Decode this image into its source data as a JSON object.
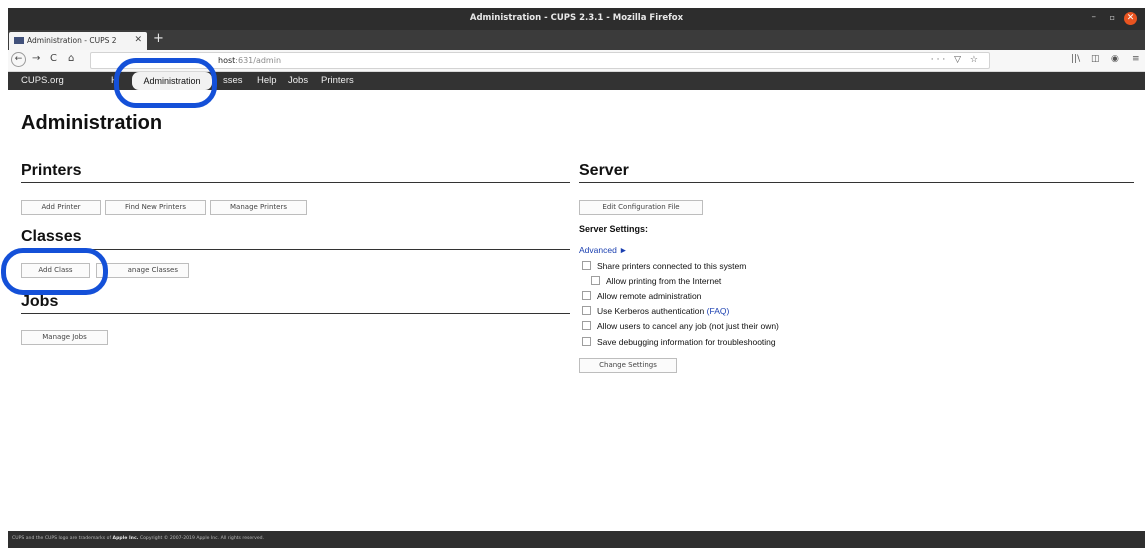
{
  "window": {
    "title": "Administration - CUPS 2.3.1 - Mozilla Firefox",
    "min": "–",
    "max": "▫",
    "close": "✕"
  },
  "tab": {
    "title": "Administration - CUPS 2",
    "close": "✕",
    "new_tab": "+"
  },
  "nav": {
    "back": "←",
    "forward": "→",
    "reload": "C",
    "home": "⌂",
    "url_host": "host",
    "url_rest": ":631/admin",
    "page_actions": "··· ▽ ☆",
    "library": "||\\",
    "sidebar": "◫",
    "account": "◉",
    "menu": "≡"
  },
  "cups_nav": {
    "cups_org": "CUPS.org",
    "home_fragment": "H",
    "administration": "Administration",
    "classes_fragment": "sses",
    "help": "Help",
    "jobs": "Jobs",
    "printers": "Printers"
  },
  "page": {
    "title": "Administration"
  },
  "printers": {
    "heading": "Printers",
    "add_printer": "Add Printer",
    "find_new_printers": "Find New Printers",
    "manage_printers": "Manage Printers"
  },
  "classes": {
    "heading": "Classes",
    "add_class": "Add Class",
    "manage_classes": "anage Classes"
  },
  "jobs": {
    "heading": "Jobs",
    "manage_jobs": "Manage Jobs"
  },
  "server": {
    "heading": "Server",
    "edit_configuration_file": "Edit Configuration File",
    "settings_label": "Server Settings:",
    "advanced": "Advanced ►",
    "options": {
      "share_printers": "Share printers connected to this system",
      "allow_internet": "Allow printing from the Internet",
      "remote_admin": "Allow remote administration",
      "kerberos": "Use Kerberos authentication",
      "faq": "(FAQ)",
      "cancel_any_job": "Allow users to cancel any job (not just their own)",
      "debug_info": "Save debugging information for troubleshooting"
    },
    "change_settings": "Change Settings"
  },
  "footer": {
    "text_before": "CUPS and the CUPS logo are trademarks of",
    "company": "Apple Inc.",
    "text_after": "Copyright © 2007-2019 Apple Inc. All rights reserved."
  },
  "colors": {
    "highlight_ring": "#1450d8",
    "link": "#1a3fb0",
    "cups_header": "#333333"
  }
}
